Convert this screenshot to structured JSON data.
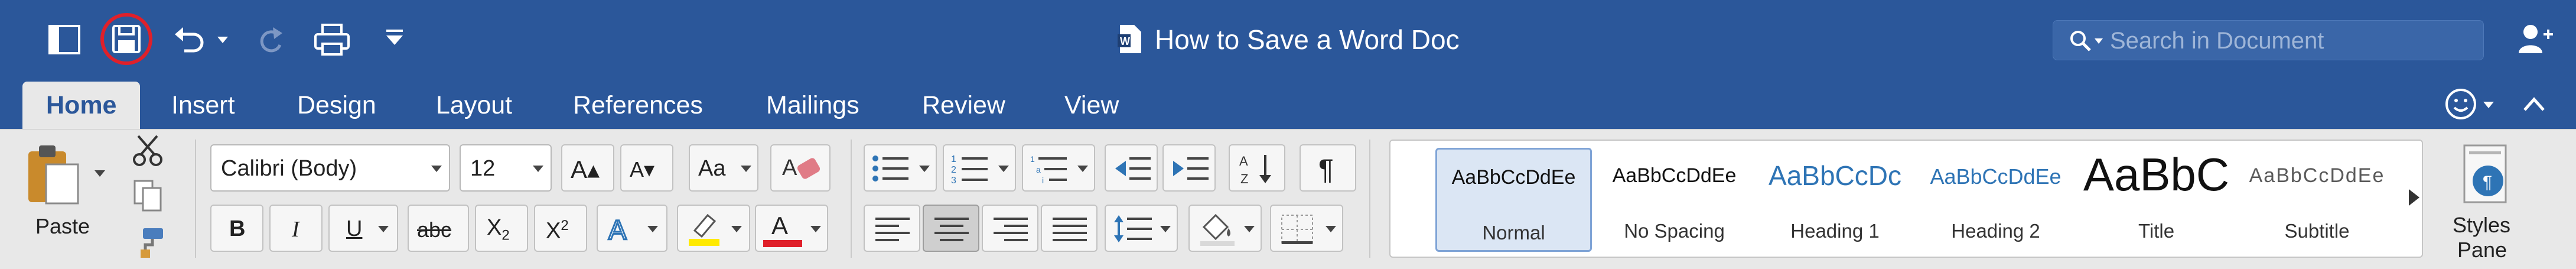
{
  "window": {
    "doc_title": "How to Save a Word Doc",
    "search_placeholder": "Search in Document"
  },
  "quick_access": {
    "icons": [
      "sidebar-icon",
      "save-icon",
      "undo-icon",
      "redo-icon",
      "print-icon",
      "customize-qat-icon"
    ],
    "highlight_color": "#e0202a"
  },
  "tabs": [
    "Home",
    "Insert",
    "Design",
    "Layout",
    "References",
    "Mailings",
    "Review",
    "View"
  ],
  "active_tab": "Home",
  "clipboard": {
    "paste_label": "Paste"
  },
  "font": {
    "name": "Calibri (Body)",
    "size": "12"
  },
  "format_buttons": {
    "bold": "B",
    "italic": "I",
    "underline": "U",
    "strike": "abc",
    "subscript": "X",
    "sub_mark": "2",
    "superscript": "X",
    "sup_mark": "2",
    "font_color": "A"
  },
  "styles": [
    {
      "preview": "AaBbCcDdEe",
      "name": "Normal"
    },
    {
      "preview": "AaBbCcDdEe",
      "name": "No Spacing"
    },
    {
      "preview": "AaBbCcDc",
      "name": "Heading 1"
    },
    {
      "preview": "AaBbCcDdEe",
      "name": "Heading 2"
    },
    {
      "preview": "AaBbC",
      "name": "Title"
    },
    {
      "preview": "AaBbCcDdEe",
      "name": "Subtitle"
    }
  ],
  "styles_pane": {
    "line1": "Styles",
    "line2": "Pane"
  },
  "colors": {
    "title_bar": "#2b579a",
    "ribbon": "#e8e8e8",
    "highlight_yellow": "#ffea00",
    "font_red": "#e0202a",
    "heading_blue": "#2e74b5"
  }
}
